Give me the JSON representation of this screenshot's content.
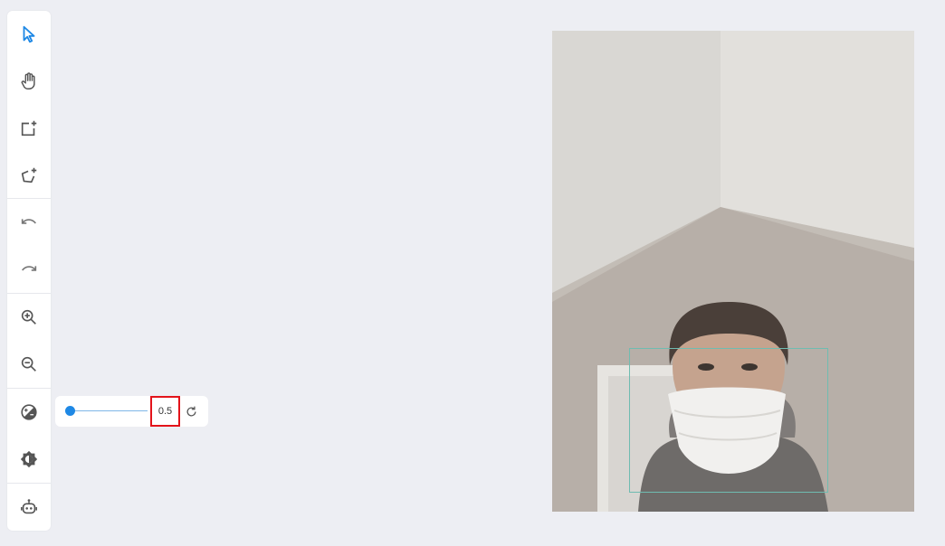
{
  "toolbar": {
    "tools": [
      {
        "name": "select-tool",
        "icon": "cursor-icon",
        "active": true
      },
      {
        "name": "pan-tool",
        "icon": "hand-icon"
      },
      {
        "name": "add-rectangle-tool",
        "icon": "add-rectangle-icon"
      },
      {
        "name": "add-polygon-tool",
        "icon": "add-polygon-icon"
      },
      {
        "name": "undo-button",
        "icon": "undo-icon"
      },
      {
        "name": "redo-button",
        "icon": "redo-icon"
      },
      {
        "name": "zoom-in-button",
        "icon": "zoom-in-icon"
      },
      {
        "name": "zoom-out-button",
        "icon": "zoom-out-icon"
      },
      {
        "name": "opacity-button",
        "icon": "opacity-icon"
      },
      {
        "name": "brightness-button",
        "icon": "brightness-icon"
      },
      {
        "name": "auto-annotate-button",
        "icon": "robot-icon"
      }
    ]
  },
  "opacity_slider": {
    "value_label": "0.5",
    "level": 0.0,
    "reset_icon": "reset-icon"
  },
  "colors": {
    "accent": "#1e88e5",
    "icon": "#555555",
    "highlight_border": "#e3131a",
    "bbox": "#6fbcb1",
    "background": "#edeef3"
  },
  "annotation": {
    "bbox_color": "#6fbcb1"
  }
}
